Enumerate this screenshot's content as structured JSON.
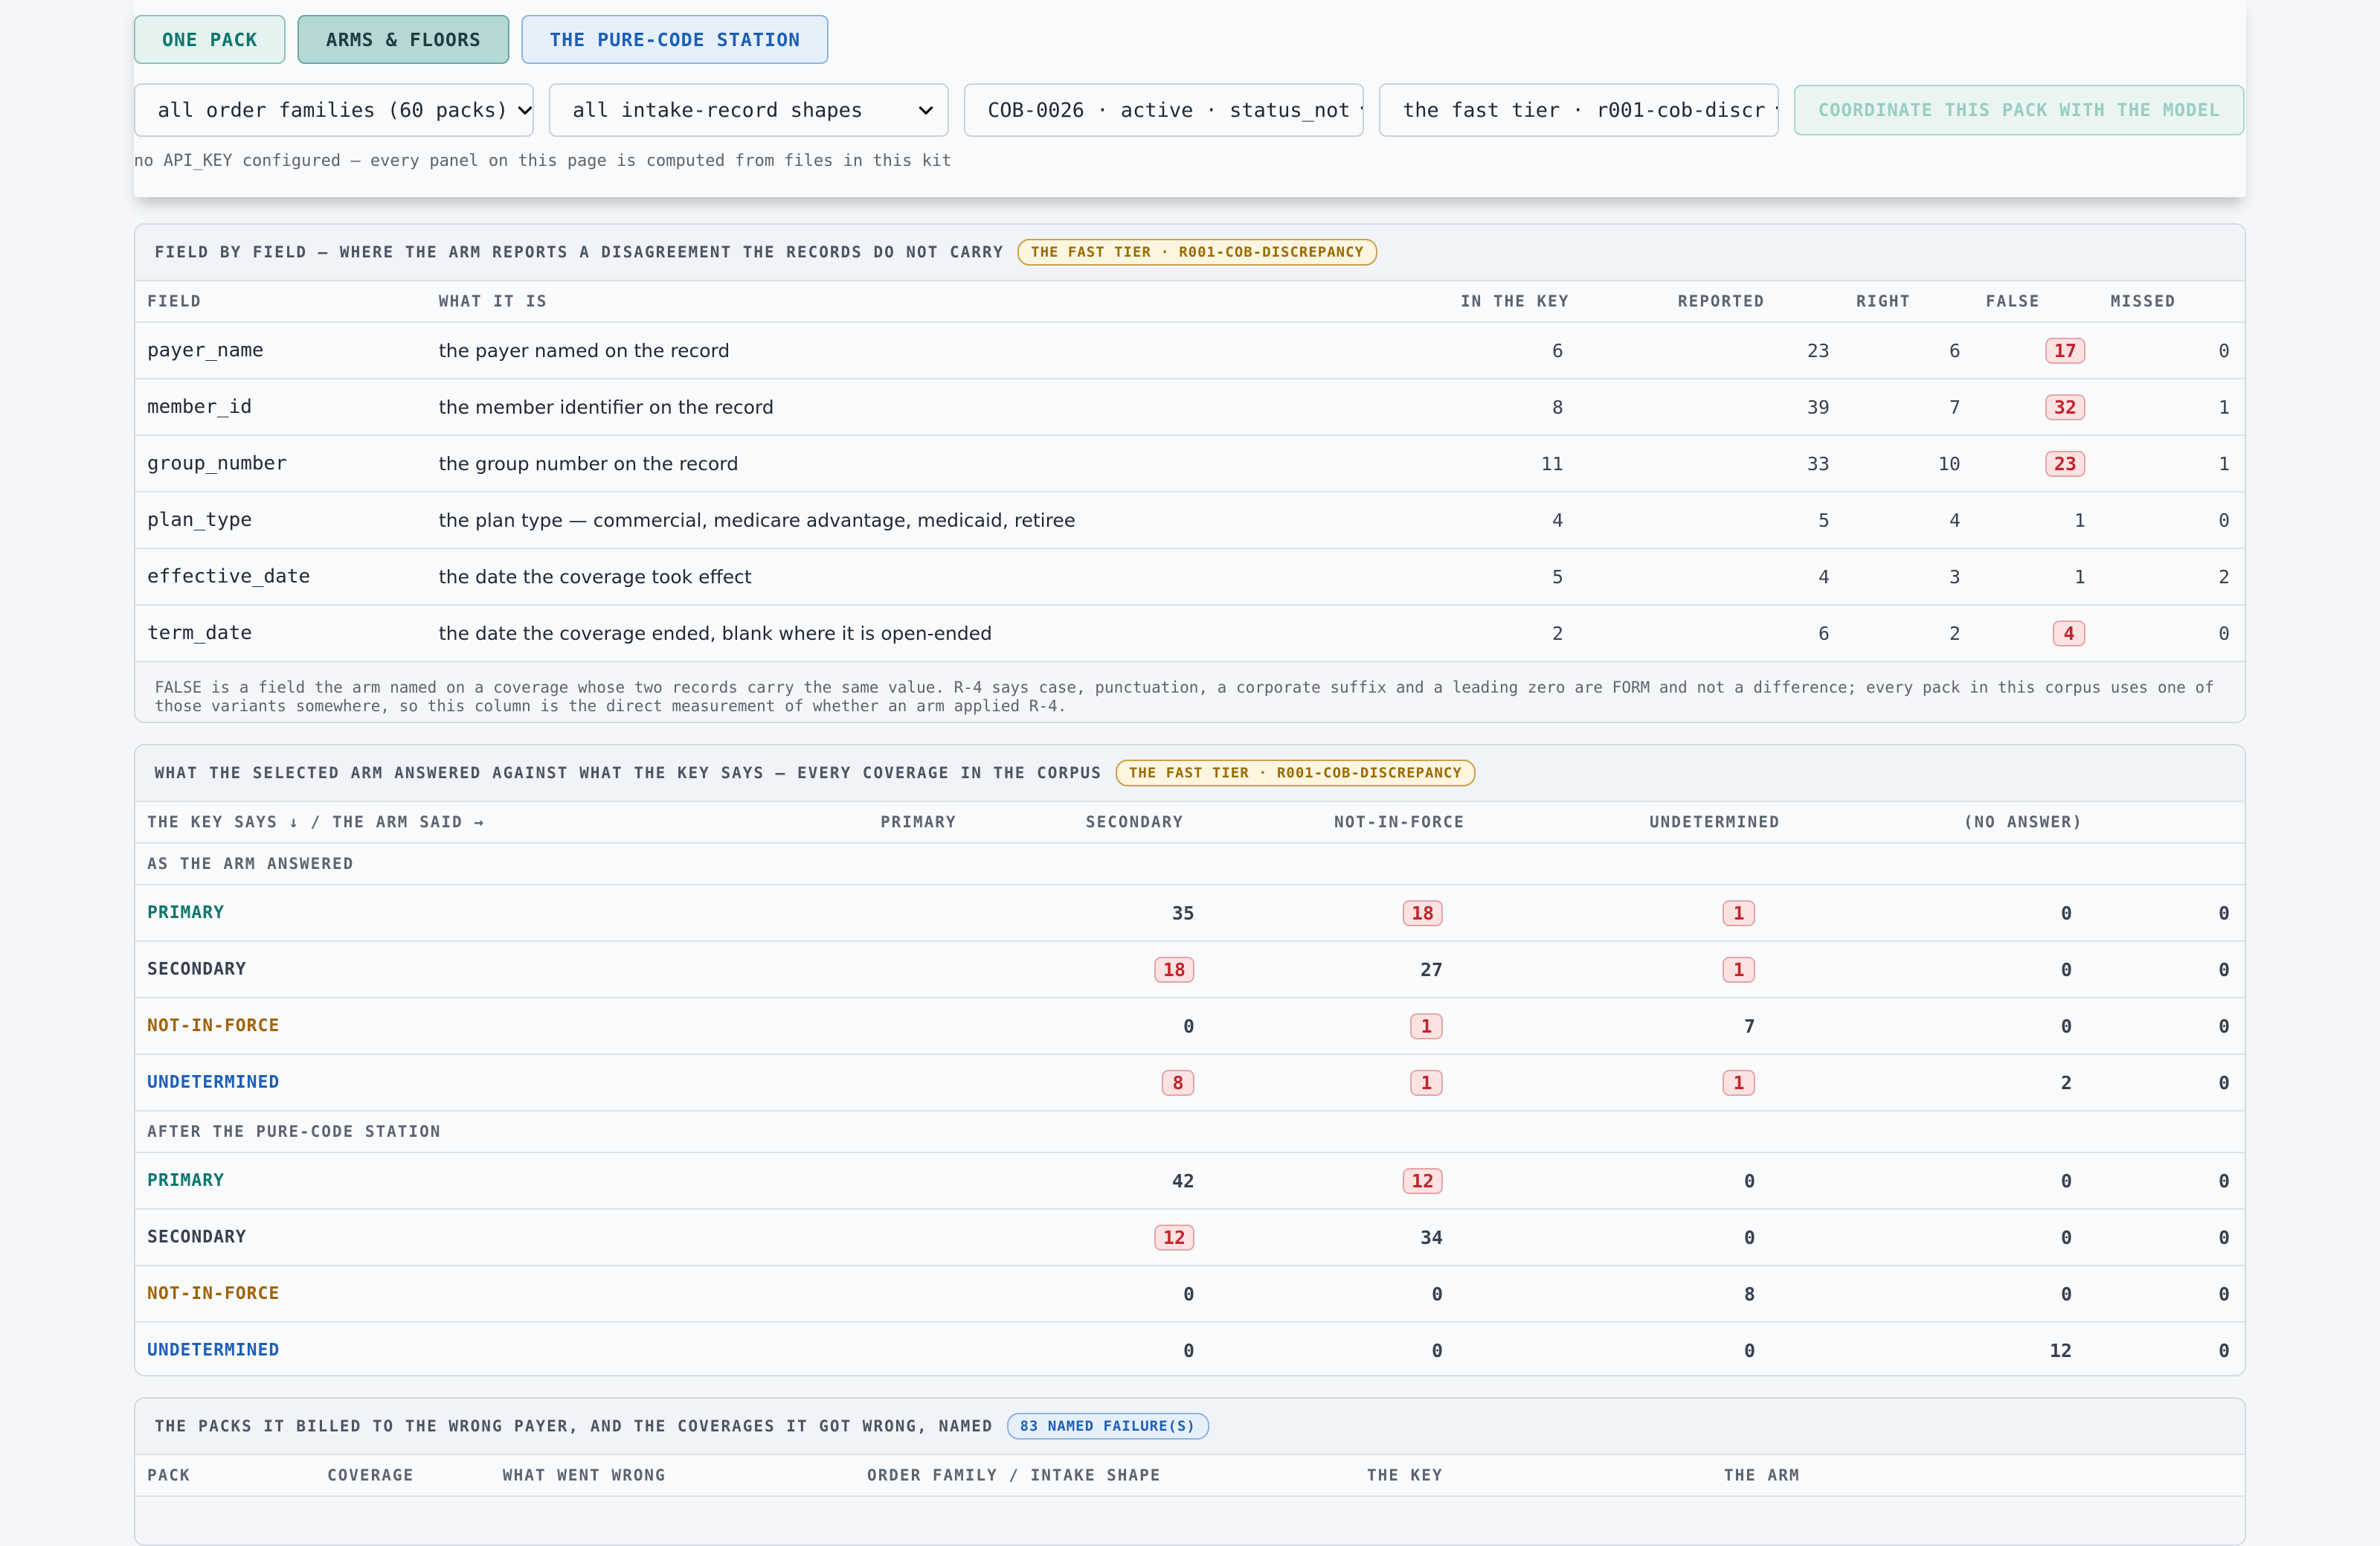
{
  "modes": [
    "ONE PACK",
    "ARMS & FLOORS",
    "THE PURE-CODE STATION"
  ],
  "filters": {
    "family": "all order families (60 packs)",
    "shape": "all intake-record shapes",
    "pack": "COB-0026 · active · status_not",
    "arm": "the fast tier · r001-cob-discr"
  },
  "coordinate_button": "COORDINATE THIS PACK WITH THE MODEL",
  "api_note": "no API_KEY configured — every panel on this page is computed from files in this kit",
  "field_panel": {
    "title": "FIELD BY FIELD — WHERE THE ARM REPORTS A DISAGREEMENT THE RECORDS DO NOT CARRY",
    "badge": "THE FAST TIER · R001-COB-DISCREPANCY",
    "columns": [
      "FIELD",
      "WHAT IT IS",
      "IN THE KEY",
      "REPORTED",
      "RIGHT",
      "FALSE",
      "MISSED"
    ],
    "rows": [
      {
        "field": "payer_name",
        "desc": "the payer named on the record",
        "key": "6",
        "reported": "23",
        "right": "6",
        "false": "17",
        "missed": "0"
      },
      {
        "field": "member_id",
        "desc": "the member identifier on the record",
        "key": "8",
        "reported": "39",
        "right": "7",
        "false": "32",
        "missed": "1"
      },
      {
        "field": "group_number",
        "desc": "the group number on the record",
        "key": "11",
        "reported": "33",
        "right": "10",
        "false": "23",
        "missed": "1"
      },
      {
        "field": "plan_type",
        "desc": "the plan type — commercial, medicare advantage, medicaid, retiree",
        "key": "4",
        "reported": "5",
        "right": "4",
        "false": "1",
        "missed": "0"
      },
      {
        "field": "effective_date",
        "desc": "the date the coverage took effect",
        "key": "5",
        "reported": "4",
        "right": "3",
        "false": "1",
        "missed": "2"
      },
      {
        "field": "term_date",
        "desc": "the date the coverage ended, blank where it is open-ended",
        "key": "2",
        "reported": "6",
        "right": "2",
        "false": "4",
        "missed": "0"
      }
    ],
    "footnote": "FALSE is a field the arm named on a coverage whose two records carry the same value. R-4 says case, punctuation, a corporate suffix and a leading zero are FORM and not a difference; every pack in this corpus uses one of those variants somewhere, so this column is the direct measurement of whether an arm applied R-4."
  },
  "matrix_panel": {
    "title": "WHAT THE SELECTED ARM ANSWERED AGAINST WHAT THE KEY SAYS — EVERY COVERAGE IN THE CORPUS",
    "badge": "THE FAST TIER · R001-COB-DISCREPANCY",
    "columns": [
      "THE KEY SAYS ↓ / THE ARM SAID →",
      "PRIMARY",
      "SECONDARY",
      "NOT-IN-FORCE",
      "UNDETERMINED",
      "(NO ANSWER)"
    ],
    "groups": [
      {
        "label": "AS THE ARM ANSWERED",
        "rows": [
          {
            "label": "PRIMARY",
            "values": [
              "35",
              "18",
              "1",
              "0",
              "0"
            ]
          },
          {
            "label": "SECONDARY",
            "values": [
              "18",
              "27",
              "1",
              "0",
              "0"
            ]
          },
          {
            "label": "NOT-IN-FORCE",
            "values": [
              "0",
              "1",
              "7",
              "0",
              "0"
            ]
          },
          {
            "label": "UNDETERMINED",
            "values": [
              "8",
              "1",
              "1",
              "2",
              "0"
            ]
          }
        ]
      },
      {
        "label": "AFTER THE PURE-CODE STATION",
        "rows": [
          {
            "label": "PRIMARY",
            "values": [
              "42",
              "12",
              "0",
              "0",
              "0"
            ]
          },
          {
            "label": "SECONDARY",
            "values": [
              "12",
              "34",
              "0",
              "0",
              "0"
            ]
          },
          {
            "label": "NOT-IN-FORCE",
            "values": [
              "0",
              "0",
              "8",
              "0",
              "0"
            ]
          },
          {
            "label": "UNDETERMINED",
            "values": [
              "0",
              "0",
              "0",
              "12",
              "0"
            ]
          }
        ]
      }
    ]
  },
  "failures_panel": {
    "title": "THE PACKS IT BILLED TO THE WRONG PAYER, AND THE COVERAGES IT GOT WRONG, NAMED",
    "badge": "83 NAMED FAILURE(S)",
    "columns": [
      "PACK",
      "COVERAGE",
      "WHAT WENT WRONG",
      "ORDER FAMILY / INTAKE SHAPE",
      "THE KEY",
      "THE ARM"
    ]
  },
  "colors": {
    "primary": "#0f766e",
    "not_in_force": "#a16207",
    "undetermined": "#1d5fb8",
    "false_pill": "#c0262d"
  },
  "icons": [
    "chevron-down-icon"
  ]
}
